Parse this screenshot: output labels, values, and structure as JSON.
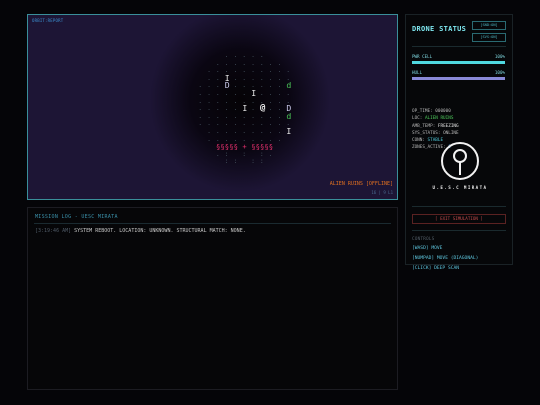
{
  "viewport": {
    "tag": "ORBIT:REPORT",
    "zone_label": "ALIEN RUINS [OFFLINE]",
    "coords": "16 | 9 L1"
  },
  "map_rows": [
    "       . . . . .       ",
    "     . . . . . . . .   ",
    "   . . . . . . . . . . ",
    "   . . I . . . . . . . ",
    " . . . D . . . . . . d ",
    " . . . . . . I . . . . ",
    " . . . . . . . . . . . ",
    " . . . . . I . @ . . D ",
    " . . . . . . . . . . d ",
    " . . . . . . . . . . . ",
    "   . . . . . . . . . I ",
    "   . . . . . . . . .   ",
    "     §§§§§ + §§§§§     ",
    "     . :   :   : .     ",
    "       : :   : :       "
  ],
  "log": {
    "title": "MISSION LOG - UESC MIRATA",
    "entries": [
      {
        "time": "[3:19:46 AM]",
        "text": "SYSTEM REBOOT. LOCATION: UNKNOWN. STRUCTURAL MATCH: NONE."
      }
    ]
  },
  "side": {
    "title": "DRONE STATUS",
    "btn_snd": "[SND:ON]",
    "btn_svs": "[SVS:ON]",
    "pwr_label": "PWR CELL",
    "pwr_value": "100%",
    "pwr_level": 1.0,
    "hull_label": "HULL",
    "hull_value": "100%",
    "hull_level": 1.0,
    "stats": [
      {
        "key": "OP_TIME:",
        "value": "000000",
        "color": "#b8b8b8"
      },
      {
        "key": "LOC:",
        "value": "ALIEN RUINS",
        "color": "#4cc85a"
      },
      {
        "key": "AMB_TEMP:",
        "value": "FREEZING",
        "color": "#e8e8e8"
      },
      {
        "key": "SYS_STATUS:",
        "value": "ONLINE",
        "color": "#b8b8b8"
      },
      {
        "key": "CONN:",
        "value": "STABLE",
        "color": "#4fc8d8"
      },
      {
        "key": "ZONES_ACTIVE:",
        "value": "0",
        "color": "#5fa8e8"
      }
    ],
    "ship_name": "U.E.S.C MIRATA",
    "exit_label": "[ EXIT SIMULATION ]",
    "controls_title": "CONTROLS",
    "controls": [
      "[WASD] MOVE",
      "[NUMPAD] MOVE (DIAGONAL)",
      "[CLICK] DEEP SCAN"
    ]
  },
  "colors": {
    "accent": "#7fe8f0",
    "player": "#f0f0f0",
    "enemy_D": "#c8c8e8",
    "enemy_d": "#4cc85a",
    "item_I": "#e8e8e8",
    "barrier": "#e0306a",
    "floor": "#4a5a66",
    "pwr_fill": "#4fd8e0",
    "hull_fill": "#8a8ad8"
  }
}
